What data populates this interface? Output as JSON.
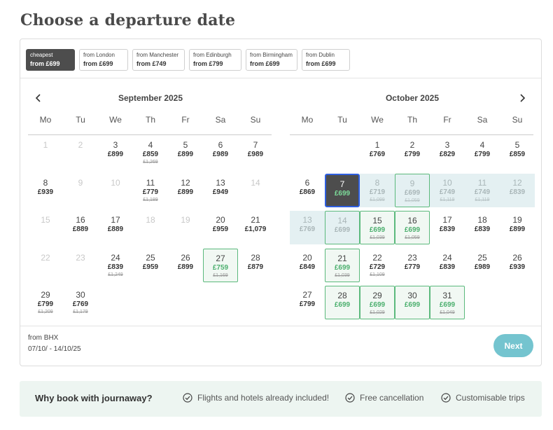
{
  "page_title": "Choose a departure date",
  "tabs": [
    {
      "from": "cheapest",
      "price": "from £699",
      "active": true
    },
    {
      "from": "from London",
      "price": "from £699",
      "active": false
    },
    {
      "from": "from Manchester",
      "price": "from £749",
      "active": false
    },
    {
      "from": "from Edinburgh",
      "price": "from £799",
      "active": false
    },
    {
      "from": "from Birmingham",
      "price": "from £699",
      "active": false
    },
    {
      "from": "from Dublin",
      "price": "from £699",
      "active": false
    }
  ],
  "weekdays": [
    "Mo",
    "Tu",
    "We",
    "Th",
    "Fr",
    "Sa",
    "Su"
  ],
  "months": [
    {
      "title": "September 2025",
      "nav": "prev",
      "weeks": [
        [
          {
            "d": "1",
            "dis": true
          },
          {
            "d": "2",
            "dis": true
          },
          {
            "d": "3",
            "p": "£899"
          },
          {
            "d": "4",
            "p": "£859",
            "o": "£1,269"
          },
          {
            "d": "5",
            "p": "£899"
          },
          {
            "d": "6",
            "p": "£989"
          },
          {
            "d": "7",
            "p": "£989"
          }
        ],
        [
          {
            "d": "8",
            "p": "£939"
          },
          {
            "d": "9",
            "dis": true
          },
          {
            "d": "10",
            "dis": true
          },
          {
            "d": "11",
            "p": "£779",
            "o": "£1,189"
          },
          {
            "d": "12",
            "p": "£899"
          },
          {
            "d": "13",
            "p": "£949"
          },
          {
            "d": "14",
            "dis": true
          }
        ],
        [
          {
            "d": "15",
            "dis": true
          },
          {
            "d": "16",
            "p": "£889"
          },
          {
            "d": "17",
            "p": "£889"
          },
          {
            "d": "18",
            "dis": true
          },
          {
            "d": "19",
            "dis": true
          },
          {
            "d": "20",
            "p": "£959"
          },
          {
            "d": "21",
            "p": "£1,079"
          }
        ],
        [
          {
            "d": "22",
            "dis": true
          },
          {
            "d": "23",
            "dis": true
          },
          {
            "d": "24",
            "p": "£839",
            "o": "£1,249"
          },
          {
            "d": "25",
            "p": "£959"
          },
          {
            "d": "26",
            "p": "£899"
          },
          {
            "d": "27",
            "p": "£759",
            "o": "£1,169",
            "cheap": true
          },
          {
            "d": "28",
            "p": "£879"
          }
        ],
        [
          {
            "d": "29",
            "p": "£799",
            "o": "£1,209"
          },
          {
            "d": "30",
            "p": "£769",
            "o": "£1,179"
          },
          null,
          null,
          null,
          null,
          null
        ]
      ]
    },
    {
      "title": "October 2025",
      "nav": "next",
      "weeks": [
        [
          null,
          null,
          {
            "d": "1",
            "p": "£769"
          },
          {
            "d": "2",
            "p": "£799"
          },
          {
            "d": "3",
            "p": "£829"
          },
          {
            "d": "4",
            "p": "£799"
          },
          {
            "d": "5",
            "p": "£859"
          }
        ],
        [
          {
            "d": "6",
            "p": "£869"
          },
          {
            "d": "7",
            "p": "£699",
            "sel": true
          },
          {
            "d": "8",
            "p": "£719",
            "o": "£1,099",
            "range": true
          },
          {
            "d": "9",
            "p": "£699",
            "o": "£1,059",
            "cheap": true,
            "range": true
          },
          {
            "d": "10",
            "p": "£749",
            "o": "£1,119",
            "range": true
          },
          {
            "d": "11",
            "p": "£749",
            "o": "£1,119",
            "range": true
          },
          {
            "d": "12",
            "p": "£839",
            "range": true
          }
        ],
        [
          {
            "d": "13",
            "p": "£769",
            "range": true
          },
          {
            "d": "14",
            "p": "£699",
            "cheap": true,
            "range": true
          },
          {
            "d": "15",
            "p": "£699",
            "o": "£1,039",
            "cheap": true
          },
          {
            "d": "16",
            "p": "£699",
            "o": "£1,059",
            "cheap": true
          },
          {
            "d": "17",
            "p": "£839"
          },
          {
            "d": "18",
            "p": "£839"
          },
          {
            "d": "19",
            "p": "£899"
          }
        ],
        [
          {
            "d": "20",
            "p": "£849"
          },
          {
            "d": "21",
            "p": "£699",
            "o": "£1,039",
            "cheap": true
          },
          {
            "d": "22",
            "p": "£729",
            "o": "£1,109"
          },
          {
            "d": "23",
            "p": "£779"
          },
          {
            "d": "24",
            "p": "£839"
          },
          {
            "d": "25",
            "p": "£989"
          },
          {
            "d": "26",
            "p": "£939"
          }
        ],
        [
          {
            "d": "27",
            "p": "£799"
          },
          {
            "d": "28",
            "p": "£699",
            "cheap": true
          },
          {
            "d": "29",
            "p": "£699",
            "o": "£1,029",
            "cheap": true
          },
          {
            "d": "30",
            "p": "£699",
            "cheap": true
          },
          {
            "d": "31",
            "p": "£699",
            "o": "£1,049",
            "cheap": true
          },
          null,
          null
        ]
      ]
    }
  ],
  "footer": {
    "from": "from BHX",
    "dates": "07/10/ - 14/10/25",
    "next_label": "Next"
  },
  "why": {
    "title": "Why book with journaway?",
    "features": [
      "Flights and hotels already included!",
      "Free cancellation",
      "Customisable trips"
    ]
  },
  "colors": {
    "accent": "#74c4cf",
    "cheap_green": "#4caf6e",
    "selected": "#4d4d4d",
    "range_bg": "#e4f0f2",
    "selected_border": "#2f5fe0"
  }
}
